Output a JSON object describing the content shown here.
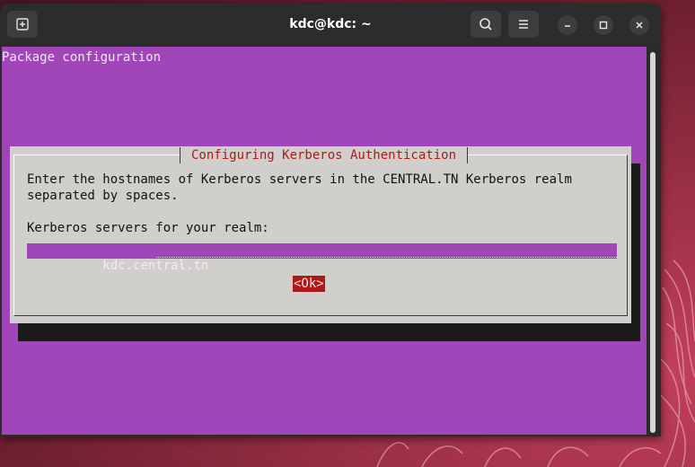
{
  "window": {
    "title": "kdc@kdc: ~",
    "buttons": {
      "new_tab": "new-tab-icon",
      "search": "search-icon",
      "menu": "hamburger-menu-icon",
      "minimize": "minimize-icon",
      "maximize": "maximize-icon",
      "close": "close-icon"
    }
  },
  "terminal": {
    "header": "Package configuration",
    "background": "#a146b8"
  },
  "dialog": {
    "title": "Configuring Kerberos Authentication",
    "description_line1": "Enter the hostnames of Kerberos servers in the CENTRAL.TN Kerberos realm",
    "description_line2": "separated by spaces.",
    "prompt": "Kerberos servers for your realm:",
    "input_value": "kdc.central.tn",
    "ok_label": "<Ok>"
  },
  "colors": {
    "dialog_bg": "#d0cfcb",
    "title_text": "#b01818",
    "ok_bg": "#b01818",
    "desktop": "#8a2a3a"
  }
}
